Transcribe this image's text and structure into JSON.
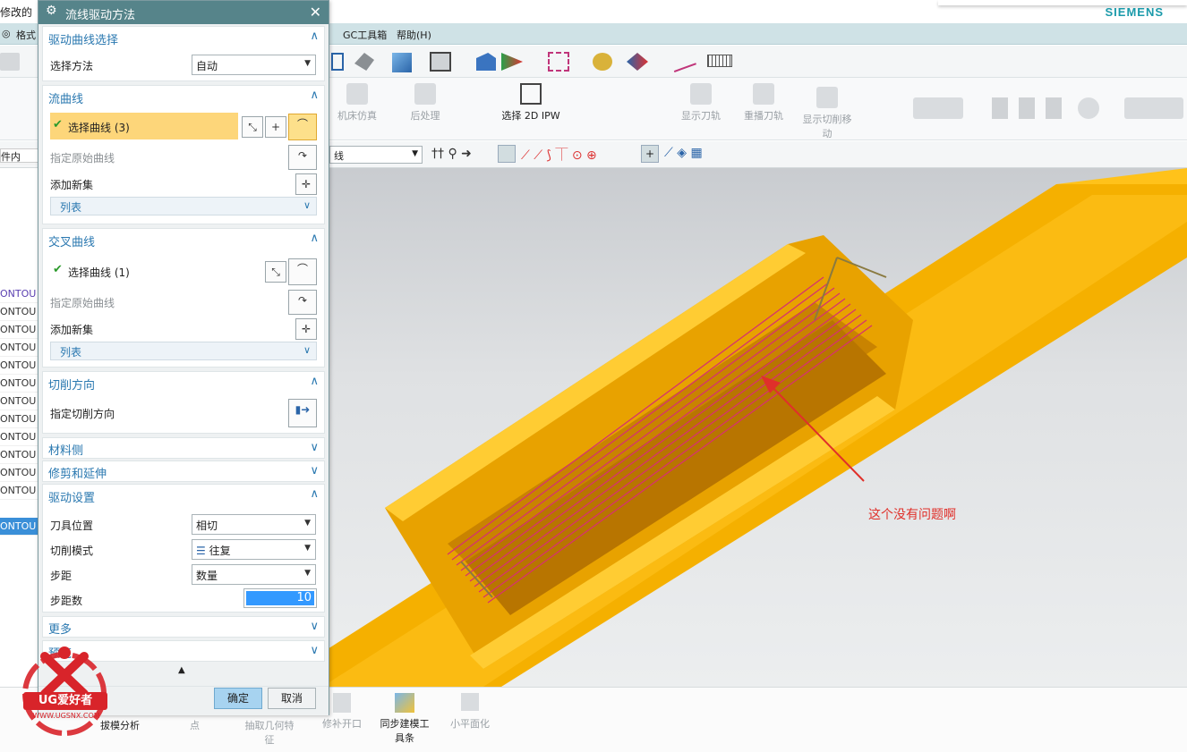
{
  "app": {
    "title_fragment": "修改的",
    "brand": "SIEMENS"
  },
  "menu": [
    "格式",
    "GC工具箱",
    "帮助(H)"
  ],
  "ribbon_buttons": [
    "机床仿真",
    "后处理",
    "选择 2D IPW",
    "显示刀轨",
    "重播刀轨",
    "显示切削移动"
  ],
  "selection_bar": {
    "filter_value": "线"
  },
  "navigator": {
    "rows": [
      "件内",
      "ONTOU",
      "ONTOU",
      "ONTOU",
      "ONTOU",
      "ONTOU",
      "ONTOU",
      "ONTOU",
      "ONTOU",
      "ONTOU",
      "ONTOU",
      "ONTOU",
      "ONTOU",
      "ONTOU"
    ]
  },
  "dialog": {
    "title": "流线驱动方法",
    "drive_curve_selection": {
      "title": "驱动曲线选择",
      "method_label": "选择方法",
      "method_value": "自动"
    },
    "flow_curves": {
      "title": "流曲线",
      "select_label": "选择曲线 (3)",
      "specify_original": "指定原始曲线",
      "add_new_set": "添加新集",
      "list_label": "列表"
    },
    "cross_curves": {
      "title": "交叉曲线",
      "select_label": "选择曲线 (1)",
      "specify_original": "指定原始曲线",
      "add_new_set": "添加新集",
      "list_label": "列表"
    },
    "cut_direction": {
      "title": "切削方向",
      "specify_label": "指定切削方向"
    },
    "material_side": {
      "title": "材料侧"
    },
    "trim_extend": {
      "title": "修剪和延伸"
    },
    "drive_settings": {
      "title": "驱动设置",
      "tool_position_label": "刀具位置",
      "tool_position_value": "相切",
      "cut_pattern_label": "切削模式",
      "cut_pattern_value": "往复",
      "stepover_label": "步距",
      "stepover_value": "数量",
      "step_count_label": "步距数",
      "step_count_value": "10"
    },
    "more": {
      "title": "更多"
    },
    "preview": {
      "title": "预览"
    },
    "ok_label": "确定",
    "cancel_label": "取消"
  },
  "bottom_buttons": [
    "拔模分析",
    "点",
    "抽取几何特征",
    "修补开口",
    "同步建模工具条",
    "小平面化"
  ],
  "watermark": {
    "brand": "UG爱好者",
    "url": "WWW.UGSNX.COM"
  },
  "annotation": "这个没有问题啊",
  "colors": {
    "dialog_title": "#56848a",
    "menu_bar": "#cfe2e6",
    "highlight_row": "#fdd67a",
    "part_body": "#f5b000",
    "toolpath": "#d6336c",
    "annotation": "#e0302a"
  }
}
